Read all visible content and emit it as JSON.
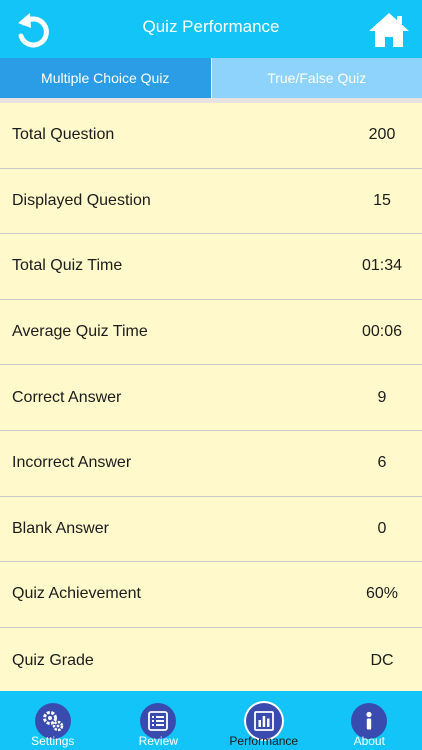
{
  "header": {
    "title": "Quiz Performance",
    "back_icon": "back-arrow-icon",
    "home_icon": "home-icon"
  },
  "tabs": [
    {
      "label": "Multiple Choice Quiz",
      "active": true
    },
    {
      "label": "True/False Quiz",
      "active": false
    }
  ],
  "stats": [
    {
      "label": "Total Question",
      "value": "200"
    },
    {
      "label": "Displayed Question",
      "value": "15"
    },
    {
      "label": "Total Quiz Time",
      "value": "01:34"
    },
    {
      "label": "Average Quiz Time",
      "value": "00:06"
    },
    {
      "label": "Correct Answer",
      "value": "9"
    },
    {
      "label": "Incorrect Answer",
      "value": "6"
    },
    {
      "label": "Blank Answer",
      "value": "0"
    },
    {
      "label": "Quiz Achievement",
      "value": "60%"
    },
    {
      "label": "Quiz Grade",
      "value": "DC"
    }
  ],
  "bottom_nav": [
    {
      "label": "Settings",
      "icon": "gears-icon",
      "active": false
    },
    {
      "label": "Review",
      "icon": "list-icon",
      "active": false
    },
    {
      "label": "Performance",
      "icon": "bar-chart-icon",
      "active": true
    },
    {
      "label": "About",
      "icon": "info-icon",
      "active": false
    }
  ],
  "colors": {
    "header": "#12c4f7",
    "tab_active": "#2a9de6",
    "tab_inactive": "#8ed3fc",
    "background": "#fff9cc",
    "nav_icon": "#3a4bb0"
  }
}
